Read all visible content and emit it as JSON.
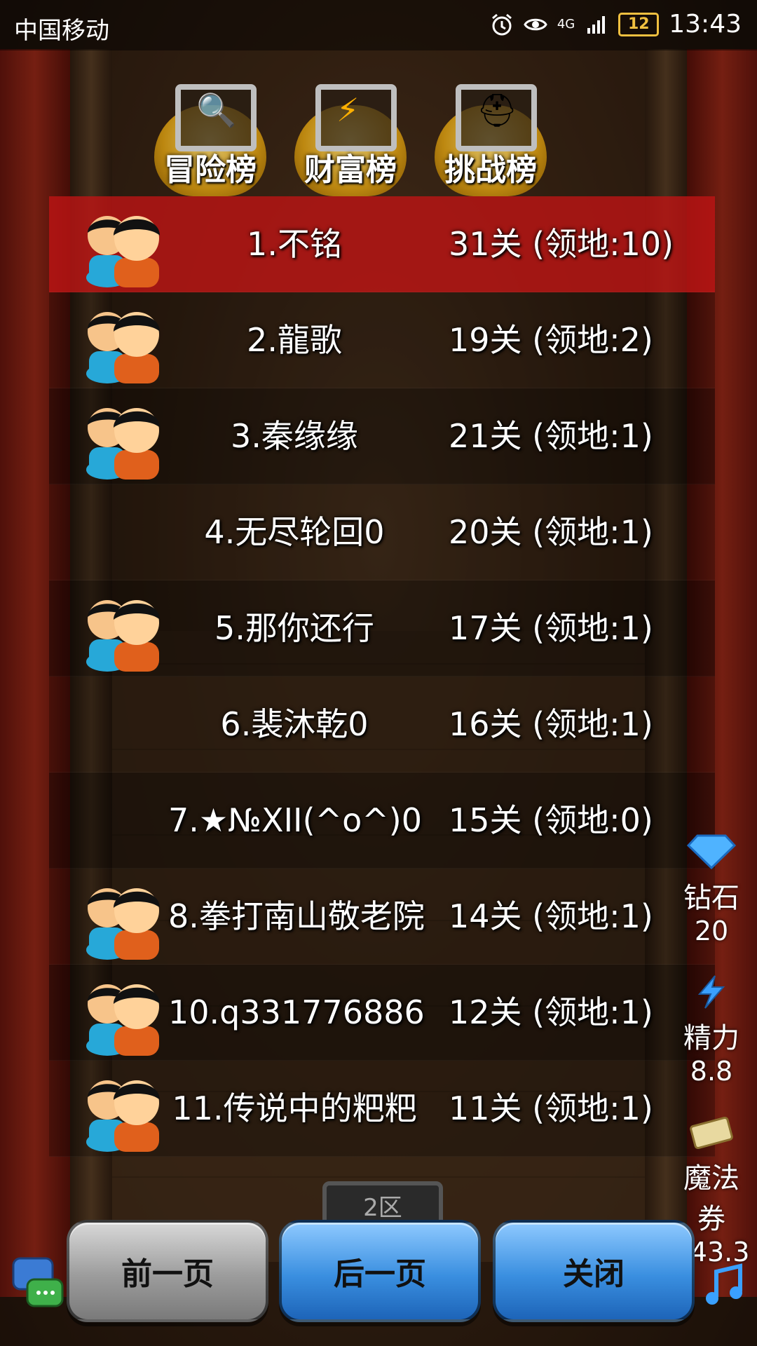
{
  "status_bar": {
    "carrier": "中国移动",
    "network": "4G",
    "battery": "12",
    "time": "13:43"
  },
  "tabs": [
    {
      "label": "冒险榜",
      "icon": "magnifier-icon"
    },
    {
      "label": "财富榜",
      "icon": "wealth-icon"
    },
    {
      "label": "挑战榜",
      "icon": "knight-helmet-icon"
    }
  ],
  "rankings": [
    {
      "name": "1.不铭",
      "score": "31关 (领地:10)",
      "has_avatar": true
    },
    {
      "name": "2.龍歌",
      "score": "19关 (领地:2)",
      "has_avatar": true
    },
    {
      "name": "3.秦缘缘",
      "score": "21关 (领地:1)",
      "has_avatar": true
    },
    {
      "name": "4.无尽轮回0",
      "score": "20关 (领地:1)",
      "has_avatar": false
    },
    {
      "name": "5.那你还行",
      "score": "17关 (领地:1)",
      "has_avatar": true
    },
    {
      "name": "6.裴沐乾0",
      "score": "16关 (领地:1)",
      "has_avatar": false
    },
    {
      "name": "7.★№XII(^o^)0",
      "score": "15关 (领地:0)",
      "has_avatar": false
    },
    {
      "name": "8.拳打南山敬老院",
      "score": "14关 (领地:1)",
      "has_avatar": true
    },
    {
      "name": "10.q331776886",
      "score": "12关 (领地:1)",
      "has_avatar": true
    },
    {
      "name": "11.传说中的粑粑",
      "score": "11关 (领地:1)",
      "has_avatar": true
    }
  ],
  "side_panel": {
    "diamond_label": "钻石",
    "diamond_value": "20",
    "energy_label": "精力",
    "energy_value": "8.8",
    "ticket_label": "魔法券",
    "ticket_value": "143.3"
  },
  "zone": "2区",
  "buttons": {
    "prev": "前一页",
    "next": "后一页",
    "close": "关闭"
  },
  "colors": {
    "highlight_row": "#be1414",
    "button_blue": "#3a8fe0",
    "button_gray": "#9c9c9c"
  }
}
